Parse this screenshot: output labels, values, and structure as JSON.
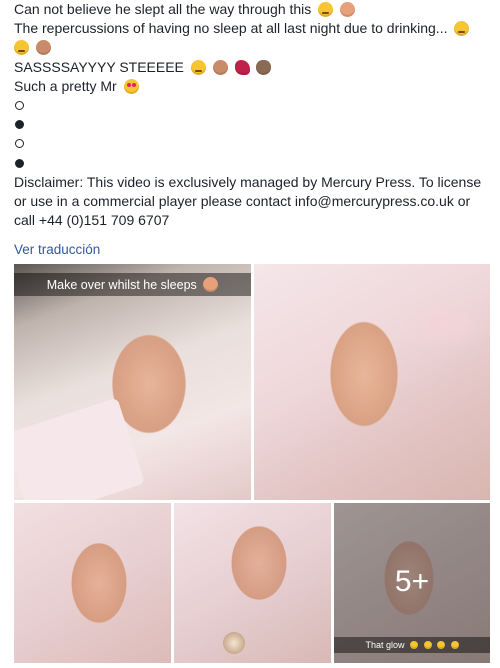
{
  "post": {
    "lines": [
      "Can not believe he slept all the way through this",
      "The repercussions of having no sleep at all last night due to drinking...",
      "SASSSSAYYYY STEEEEE",
      "Such a pretty Mr"
    ],
    "bullets": [
      "empty",
      "filled",
      "empty",
      "filled"
    ],
    "disclaimer": "Disclaimer: This video is exclusively managed by Mercury Press. To license or use in a commercial player please contact info@mercurypress.co.uk or call +44 (0)151 709 6707",
    "translate_link": "Ver traducción"
  },
  "emojis": {
    "line1": [
      "grinning-sweat-emoji",
      "person-emoji"
    ],
    "line2": [
      "smirk-emoji"
    ],
    "line2b": [
      "smirk-emoji",
      "woman-emoji"
    ],
    "line3": [
      "smirk-emoji",
      "woman-emoji",
      "high-heel-emoji",
      "bunny-emoji"
    ],
    "line4": [
      "heart-eyes-emoji"
    ]
  },
  "photos": {
    "first_caption": "Make over whilst he sleeps",
    "last_caption": "That glow",
    "more_count": "5+"
  },
  "colors": {
    "link": "#365899",
    "text": "#1d2129"
  }
}
